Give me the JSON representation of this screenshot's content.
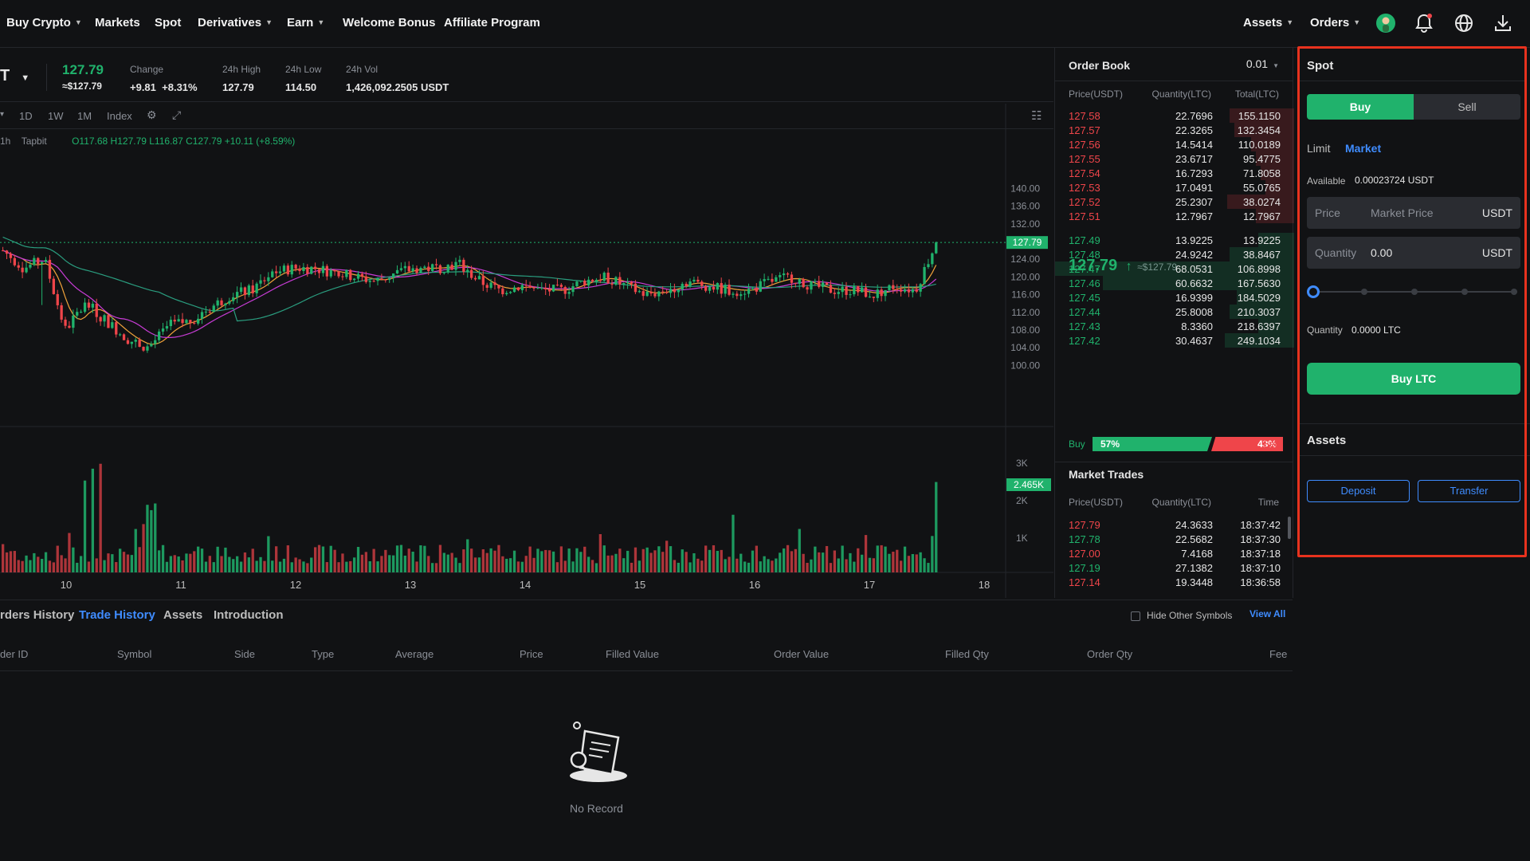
{
  "nav": {
    "items": [
      {
        "label": "Buy Crypto",
        "chevron": true
      },
      {
        "label": "Markets",
        "chevron": false
      },
      {
        "label": "Spot",
        "chevron": false
      },
      {
        "label": "Derivatives",
        "chevron": true
      },
      {
        "label": "Earn",
        "chevron": true
      },
      {
        "label": "Welcome Bonus",
        "chevron": false
      },
      {
        "label": "Affiliate Program",
        "chevron": false
      }
    ],
    "assets": "Assets",
    "orders": "Orders"
  },
  "ticker": {
    "pair_suffix": "T",
    "price": "127.79",
    "price_usd": "≈$127.79",
    "change_label": "Change",
    "change_value": "+9.81",
    "change_pct": "+8.31%",
    "high_label": "24h High",
    "high_value": "127.79",
    "low_label": "24h Low",
    "low_value": "114.50",
    "vol_label": "24h Vol",
    "vol_value": "1,426,092.2505 USDT"
  },
  "chart_toolbar": {
    "intervals": [
      "1D",
      "1W",
      "1M",
      "Index"
    ]
  },
  "chart_info": {
    "interval": "1h",
    "source": "Tapbit",
    "ohlc": "O117.68 H127.79 L116.87 C127.79 +10.11 (+8.59%)"
  },
  "chart_data": {
    "type": "candlestick",
    "y_ticks": [
      "140.00",
      "136.00",
      "132.00",
      "128.00",
      "124.00",
      "120.00",
      "116.00",
      "112.00",
      "108.00",
      "104.00",
      "100.00"
    ],
    "ylim": [
      100,
      140
    ],
    "last_price_tag": "127.79",
    "volume_ticks": [
      "3K",
      "2K",
      "1K"
    ],
    "volume_last_tag": "2.465K",
    "x_ticks": [
      "10",
      "11",
      "12",
      "13",
      "14",
      "15",
      "16",
      "17",
      "18"
    ],
    "close_path": [
      126,
      122,
      124,
      108,
      114,
      110,
      106,
      104,
      109,
      110,
      113,
      116,
      117,
      121,
      122,
      122,
      121,
      120,
      119,
      121,
      122,
      122,
      123,
      119,
      117,
      118,
      117,
      117,
      119,
      120,
      118,
      116,
      117,
      119,
      118,
      117,
      117,
      119,
      120,
      118,
      117,
      117,
      116,
      118,
      117,
      127.79
    ]
  },
  "orderbook": {
    "title": "Order Book",
    "precision": "0.01",
    "headers": [
      "Price(USDT)",
      "Quantity(LTC)",
      "Total(LTC)"
    ],
    "asks": [
      {
        "price": "127.58",
        "qty": "22.7696",
        "total": "155.1150",
        "depth": 0.27
      },
      {
        "price": "127.57",
        "qty": "22.3265",
        "total": "132.3454",
        "depth": 0.25
      },
      {
        "price": "127.56",
        "qty": "14.5414",
        "total": "110.0189",
        "depth": 0.18
      },
      {
        "price": "127.55",
        "qty": "23.6717",
        "total": "95.4775",
        "depth": 0.16
      },
      {
        "price": "127.54",
        "qty": "16.7293",
        "total": "71.8058",
        "depth": 0.14
      },
      {
        "price": "127.53",
        "qty": "17.0491",
        "total": "55.0765",
        "depth": 0.12
      },
      {
        "price": "127.52",
        "qty": "25.2307",
        "total": "38.0274",
        "depth": 0.28
      },
      {
        "price": "127.51",
        "qty": "12.7967",
        "total": "12.7967",
        "depth": 0.16
      }
    ],
    "mid_price": "127.79",
    "mid_usd": "≈$127.79",
    "bids": [
      {
        "price": "127.49",
        "qty": "13.9225",
        "total": "13.9225",
        "depth": 0.15
      },
      {
        "price": "127.48",
        "qty": "24.9242",
        "total": "38.8467",
        "depth": 0.27
      },
      {
        "price": "127.47",
        "qty": "68.0531",
        "total": "106.8998",
        "depth": 1.0
      },
      {
        "price": "127.46",
        "qty": "60.6632",
        "total": "167.5630",
        "depth": 0.8
      },
      {
        "price": "127.45",
        "qty": "16.9399",
        "total": "184.5029",
        "depth": 0.24
      },
      {
        "price": "127.44",
        "qty": "25.8008",
        "total": "210.3037",
        "depth": 0.27
      },
      {
        "price": "127.43",
        "qty": "8.3360",
        "total": "218.6397",
        "depth": 0.15
      },
      {
        "price": "127.42",
        "qty": "30.4637",
        "total": "249.1034",
        "depth": 0.29
      }
    ],
    "buy_label": "Buy",
    "buy_pct": "57%",
    "sell_pct": "43%",
    "sell_label": "Sell"
  },
  "market_trades": {
    "title": "Market Trades",
    "headers": [
      "Price(USDT)",
      "Quantity(LTC)",
      "Time"
    ],
    "rows": [
      {
        "price": "127.79",
        "qty": "24.3633",
        "time": "18:37:42",
        "side": "sell"
      },
      {
        "price": "127.78",
        "qty": "22.5682",
        "time": "18:37:30",
        "side": "buy"
      },
      {
        "price": "127.00",
        "qty": "7.4168",
        "time": "18:37:18",
        "side": "sell"
      },
      {
        "price": "127.19",
        "qty": "27.1382",
        "time": "18:37:10",
        "side": "buy"
      },
      {
        "price": "127.14",
        "qty": "19.3448",
        "time": "18:36:58",
        "side": "sell"
      }
    ]
  },
  "bottom": {
    "tabs": [
      "rders History",
      "Trade History",
      "Assets",
      "Introduction"
    ],
    "hide_other": "Hide Other Symbols",
    "view_all": "View All",
    "columns": [
      "der ID",
      "Symbol",
      "Side",
      "Type",
      "Average",
      "Price",
      "Filled Value",
      "Order Value",
      "Filled Qty",
      "Order Qty",
      "Fee"
    ],
    "empty": "No Record"
  },
  "spot": {
    "title": "Spot",
    "buy": "Buy",
    "sell": "Sell",
    "limit": "Limit",
    "market": "Market",
    "available_label": "Available",
    "available_value": "0.00023724 USDT",
    "price_label": "Price",
    "price_placeholder": "Market Price",
    "price_unit": "USDT",
    "qty_label": "Quantity",
    "qty_value": "0.00",
    "qty_unit": "USDT",
    "slider_level": 0,
    "qty_summary_label": "Quantity",
    "qty_summary_value": "0.0000 LTC",
    "buy_button": "Buy LTC",
    "assets_title": "Assets",
    "deposit": "Deposit",
    "transfer": "Transfer"
  },
  "colors": {
    "green": "#20b26c",
    "red": "#ef454a",
    "accent": "#3f8cff",
    "highlight": "#e8321e"
  }
}
